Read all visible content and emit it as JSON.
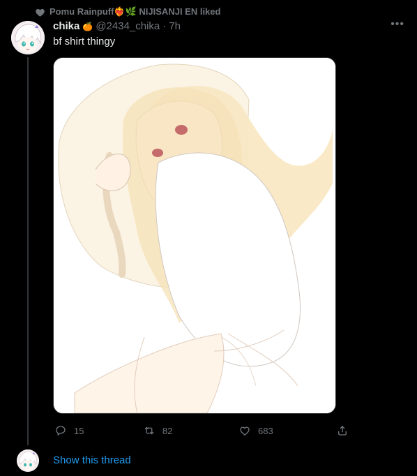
{
  "social_context": {
    "icon": "heart-icon",
    "text": "Pomu Rainpuff❤️‍🔥🌿 NIJISANJI EN liked",
    "label_start": "Pomu Rainpuff",
    "label_end": "NIJISANJI EN liked"
  },
  "tweet": {
    "display_name": "chika",
    "name_emoji": "🍊",
    "handle": "@2434_chika",
    "separator": "·",
    "time": "7h",
    "text": "bf shirt thingy",
    "more_label": "•••",
    "stats": {
      "replies": "15",
      "retweets": "82",
      "likes": "683"
    }
  },
  "thread": {
    "show_label": "Show this thread"
  },
  "colors": {
    "background": "#000000",
    "text_primary": "#e7e9ea",
    "text_secondary": "#71767b",
    "link": "#1d9bf0"
  }
}
